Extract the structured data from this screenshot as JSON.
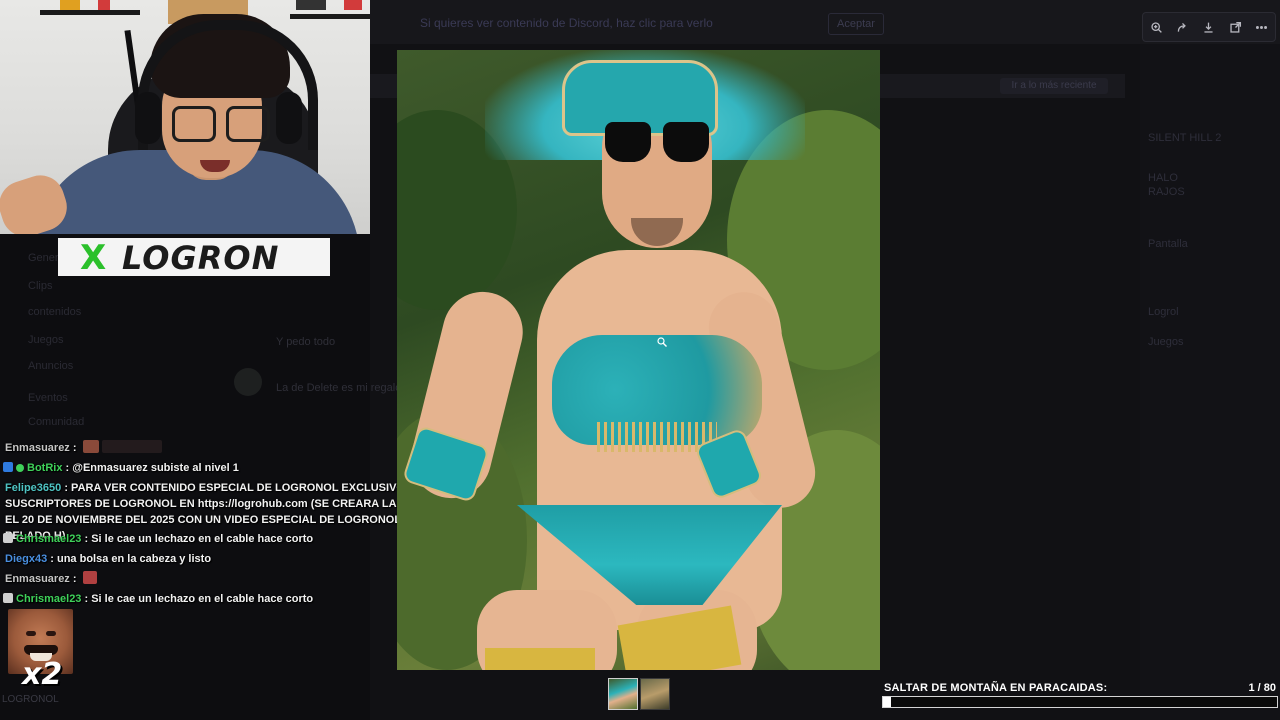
{
  "background_app": {
    "banner_text": "Si quieres ver contenido de Discord, haz clic para verlo",
    "banner_button": "Aceptar",
    "subbar_button": "Ir a lo más reciente",
    "right_items": [
      "SILENT HILL 2",
      "HALO",
      "RAJOS",
      "Pantalla",
      "Logrol",
      "Juegos"
    ],
    "left_items": [
      "General",
      "Clips",
      "contenidos",
      "Juegos",
      "Anuncios",
      "Eventos",
      "Comunidad"
    ],
    "mid_texts": [
      "Y pedo todo",
      "La de Delete es mi regalo"
    ]
  },
  "viewer_toolbar": {
    "buttons": [
      {
        "icon": "zoom-icon"
      },
      {
        "icon": "share-icon"
      },
      {
        "icon": "download-icon"
      },
      {
        "icon": "open-external-icon"
      },
      {
        "icon": "more-icon"
      }
    ]
  },
  "logo": {
    "mark": "X",
    "text": "LOGRON"
  },
  "chat": {
    "lines": [
      {
        "user": "Enmasuarez",
        "user_color": "#c6c6c6",
        "text": ""
      },
      {
        "user": "BotRix",
        "user_color": "#3fd15a",
        "text": "@Enmasuarez subiste al nivel 1"
      },
      {
        "user": "Felipe3650",
        "user_color": "#4fc4c4",
        "text": "PARA VER CONTENIDO ESPECIAL DE LOGRONOL EXCLUSIVO PARA SUSCRIPTORES DE LOGRONOL EN https://logrohub.com (SE CREARA LA PAGINA EL 20 DE NOVIEMBRE DEL 2025 CON UN VIDEO ESPECIAL DE LOGRONOL CON PELADO H)"
      },
      {
        "user": "Chrismael23",
        "user_color": "#3fd15a",
        "text": "Si le cae un lechazo en el cable hace corto"
      },
      {
        "user": "Diegx43",
        "user_color": "#4a8fe0",
        "text": "una bolsa en la cabeza y listo"
      },
      {
        "user": "Enmasuarez",
        "user_color": "#c6c6c6",
        "text": ""
      },
      {
        "user": "Chrismael23",
        "user_color": "#3fd15a",
        "text": "Si le cae un lechazo en el cable hace corto"
      }
    ],
    "separator": " : ",
    "emote_multiplier": "x2",
    "bottom_name": "LOGRONOL"
  },
  "thumbnails": [
    {
      "active": true
    },
    {
      "active": false
    }
  ],
  "challenge": {
    "title": "SALTAR DE MONTAÑA EN PARACAIDAS:",
    "count_text": "1  / 80",
    "current": 1,
    "total": 80
  }
}
